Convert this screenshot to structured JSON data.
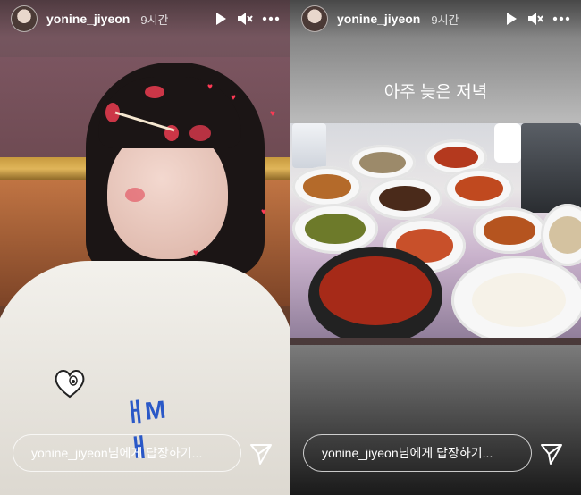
{
  "stories": [
    {
      "username": "yonine_jiyeon",
      "time_ago": "9시간",
      "caption": "",
      "reply_placeholder": "yonine_jiyeon님에게 답장하기...",
      "patch_text": "ㅐMㅐ"
    },
    {
      "username": "yonine_jiyeon",
      "time_ago": "9시간",
      "caption": "아주 늦은 저녁",
      "reply_placeholder": "yonine_jiyeon님에게 답장하기..."
    }
  ],
  "icons": {
    "play": "play-icon",
    "mute": "mute-icon",
    "more": "more-options-icon",
    "send": "send-icon"
  },
  "colors": {
    "text": "#ffffff",
    "reply_border": "#ffffffbf",
    "sticker_red": "#e03a4d",
    "sweater_logo_blue": "#2a58c7"
  }
}
